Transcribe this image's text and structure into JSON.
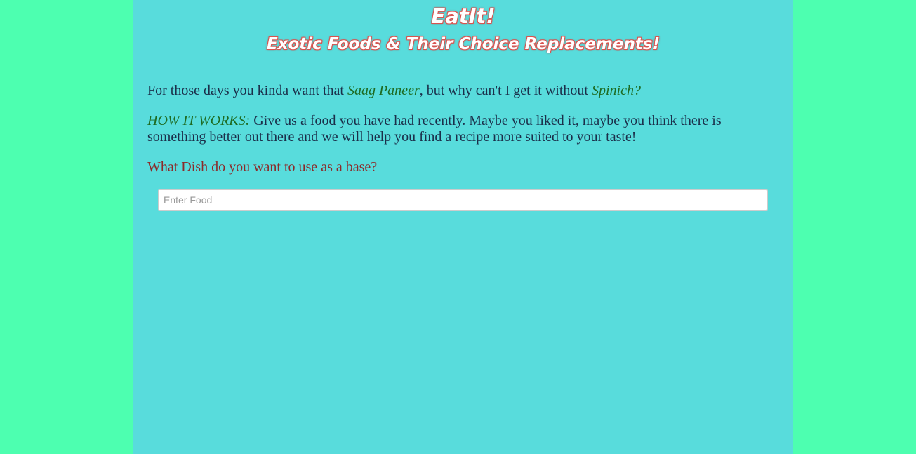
{
  "header": {
    "title": "EatIt!",
    "subtitle": "Exotic Foods & Their Choice Replacements!"
  },
  "intro": {
    "prefix": "For those days you kinda want that ",
    "dish": "Saag Paneer",
    "middle": ", but why can't I get it without ",
    "ingredient": "Spinich?"
  },
  "how_it_works": {
    "label": "HOW IT WORKS:",
    "text": " Give us a food you have had recently. Maybe you liked it, maybe you think there is something better out there and we will help you find a recipe more suited to your taste!"
  },
  "question": "What Dish do you want to use as a base?",
  "search": {
    "placeholder": "Enter Food",
    "value": ""
  },
  "colors": {
    "outer_background": "#4dffb0",
    "panel_background": "#58dcdc",
    "title_outline": "#d9534f",
    "accent": "#1e6b22",
    "question": "#8b2a2a"
  }
}
